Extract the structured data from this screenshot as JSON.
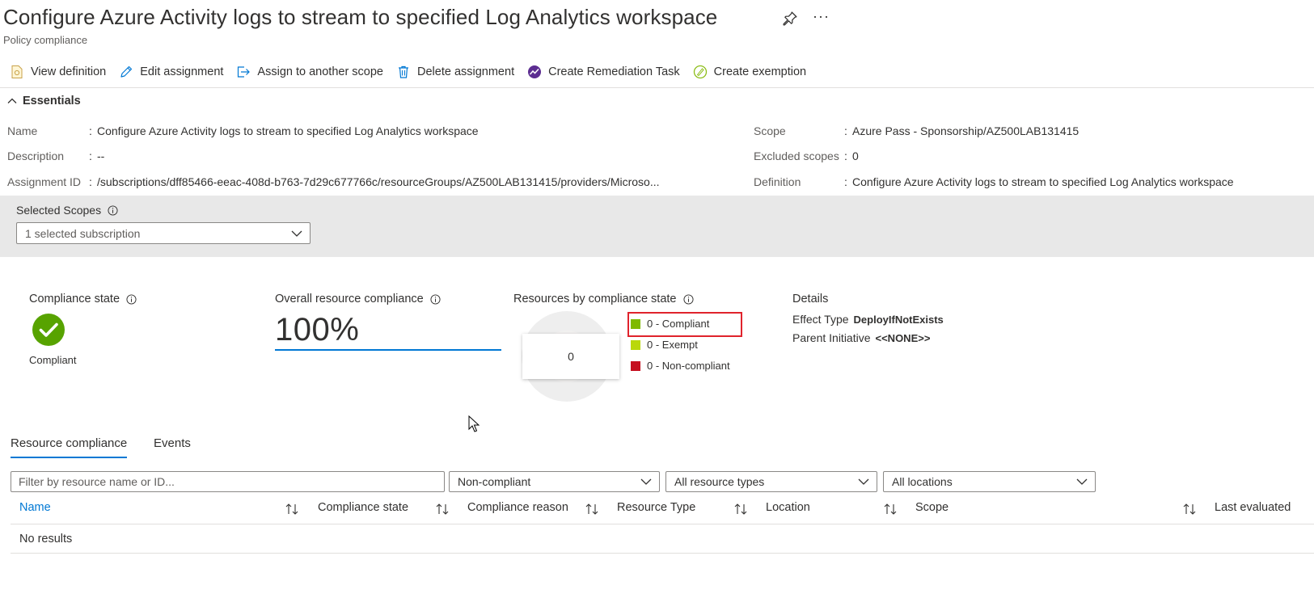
{
  "header": {
    "title": "Configure Azure Activity logs to stream to specified Log Analytics workspace",
    "subtitle": "Policy compliance",
    "more_label": "···"
  },
  "toolbar": {
    "view_definition": "View definition",
    "edit_assignment": "Edit assignment",
    "assign_scope": "Assign to another scope",
    "delete_assignment": "Delete assignment",
    "create_remediation": "Create Remediation Task",
    "create_exemption": "Create exemption"
  },
  "essentials": {
    "toggle_label": "Essentials",
    "left": [
      {
        "label": "Name",
        "value": "Configure Azure Activity logs to stream to specified Log Analytics workspace"
      },
      {
        "label": "Description",
        "value": "--"
      },
      {
        "label": "Assignment ID",
        "value": "/subscriptions/dff85466-eeac-408d-b763-7d29c677766c/resourceGroups/AZ500LAB131415/providers/Microso..."
      }
    ],
    "right": [
      {
        "label": "Scope",
        "value": "Azure Pass - Sponsorship/AZ500LAB131415"
      },
      {
        "label": "Excluded scopes",
        "value": "0"
      },
      {
        "label": "Definition",
        "value": "Configure Azure Activity logs to stream to specified Log Analytics workspace"
      }
    ]
  },
  "scopes": {
    "label": "Selected Scopes",
    "selected": "1 selected subscription"
  },
  "summary": {
    "compliance_state_title": "Compliance state",
    "compliance_state_value": "Compliant",
    "overall_title": "Overall resource compliance",
    "overall_value": "100%",
    "by_state_title": "Resources by compliance state",
    "tooltip_value": "0",
    "legend": [
      {
        "label": "0 - Compliant",
        "color": "#7fba00"
      },
      {
        "label": "0 - Exempt",
        "color": "#bad80a"
      },
      {
        "label": "0 - Non-compliant",
        "color": "#c50f1f"
      }
    ],
    "details_title": "Details",
    "effect_type_label": "Effect Type",
    "effect_type_value": "DeployIfNotExists",
    "parent_initiative_label": "Parent Initiative",
    "parent_initiative_value": "<<NONE>>"
  },
  "tabs": [
    {
      "label": "Resource compliance",
      "active": true
    },
    {
      "label": "Events",
      "active": false
    }
  ],
  "filters": {
    "search_placeholder": "Filter by resource name or ID...",
    "state": "Non-compliant",
    "types": "All resource types",
    "locations": "All locations"
  },
  "table": {
    "columns": [
      "Name",
      "Compliance state",
      "Compliance reason",
      "Resource Type",
      "Location",
      "Scope",
      "Last evaluated"
    ],
    "empty_message": "No results"
  },
  "colors": {
    "accent": "#0078d4",
    "compliant": "#57a300",
    "highlight": "#e0232c"
  }
}
